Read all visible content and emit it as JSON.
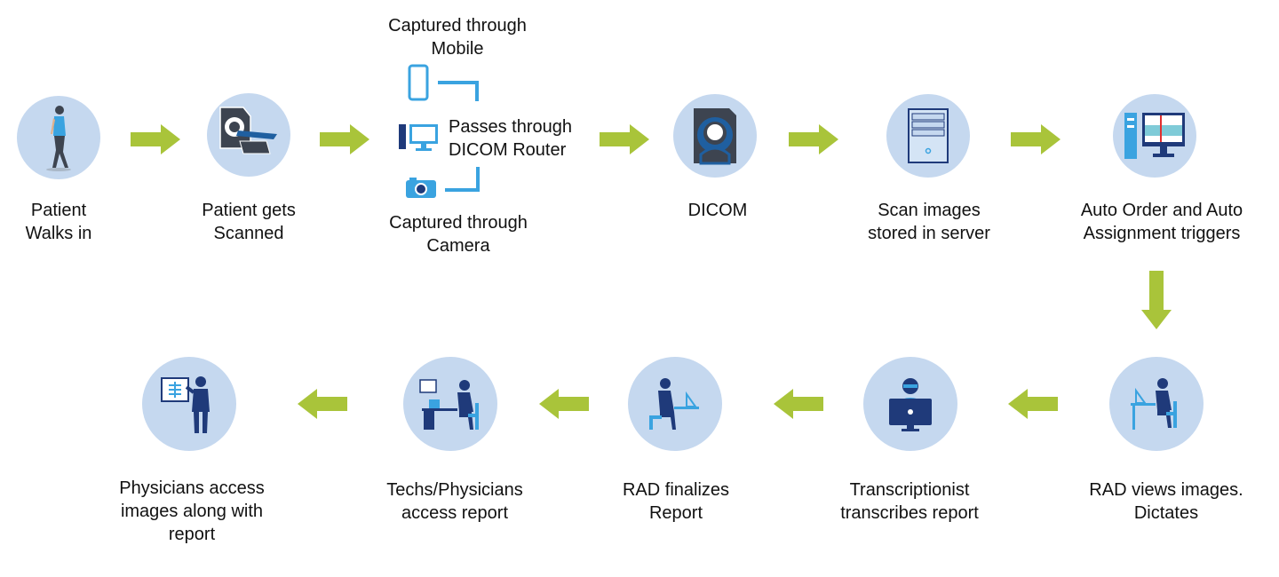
{
  "colors": {
    "circle": "#c5d8ef",
    "arrow": "#a9c43a",
    "navy": "#1f3a7a",
    "light_blue": "#3aa3e0",
    "dark_gray": "#3d4450"
  },
  "steps": [
    {
      "label1": "Patient",
      "label2": "Walks in",
      "icon": "walking-person-icon"
    },
    {
      "label1": "Patient gets",
      "label2": "Scanned",
      "icon": "ct-scanner-icon"
    },
    {
      "label1": "DICOM",
      "label2": "",
      "icon": "mri-machine-icon"
    },
    {
      "label1": "Scan images",
      "label2": "stored in server",
      "icon": "server-icon"
    },
    {
      "label1": "Auto Order and Auto",
      "label2": "Assignment triggers",
      "icon": "computer-workstation-icon"
    },
    {
      "label1": "RAD views images.",
      "label2": "Dictates",
      "icon": "radiologist-desk-icon"
    },
    {
      "label1": "Transcriptionist",
      "label2": "transcribes report",
      "icon": "transcriptionist-icon"
    },
    {
      "label1": "RAD finalizes",
      "label2": "Report",
      "icon": "radiologist-laptop-icon"
    },
    {
      "label1": "Techs/Physicians",
      "label2": "access report",
      "icon": "tech-desk-icon"
    },
    {
      "label1": "Physicians access",
      "label2": "images along with",
      "label3": "report",
      "icon": "physician-xray-icon"
    }
  ],
  "router": {
    "mobile_1": "Captured through",
    "mobile_2": "Mobile",
    "router_1": "Passes through",
    "router_2": "DICOM Router",
    "camera_1": "Captured through",
    "camera_2": "Camera"
  }
}
